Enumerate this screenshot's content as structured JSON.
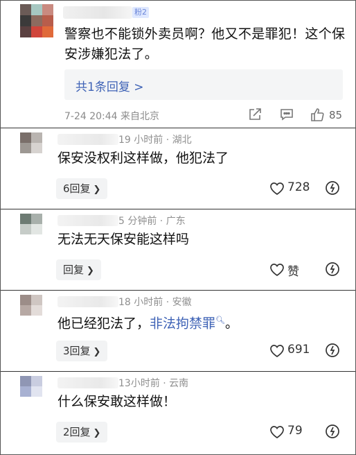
{
  "top_comment": {
    "badge": "粉2",
    "text": "警察也不能锁外卖员啊？他又不是罪犯！这个保安涉嫌犯法了。",
    "reply_link": "共1条回复 >",
    "meta": "7-24 20:44  来自北京",
    "like_count": "85",
    "avatar_colors": [
      "#6b5b57",
      "#a6c7c1",
      "#c98a80",
      "#3b3a3a",
      "#8d6b5f",
      "#b85d4b",
      "#5a4040",
      "#d0453b",
      "#e06a3a"
    ]
  },
  "comments": [
    {
      "time": "19 小时前 · 湖北",
      "text": "保安没权利这样做，他犯法了",
      "reply_label": "6回复",
      "like_count": "728",
      "avatar_colors": [
        "#7a6f6a",
        "#b9b4b0",
        "#9d9893",
        "#d7d3d0"
      ]
    },
    {
      "time": "5 分钟前 · 广东",
      "text": "无法无天保安能这样吗",
      "reply_label": "回复",
      "like_count": "赞",
      "avatar_colors": [
        "#6d7b73",
        "#a8b0ab",
        "#c6ccc8",
        "#e2e6e3"
      ]
    },
    {
      "time": "18 小时前 · 安徽",
      "text_before": "他已经犯法了，",
      "link_text": "非法拘禁罪",
      "text_after": "。",
      "reply_label": "3回复",
      "like_count": "691",
      "avatar_colors": [
        "#9c8d88",
        "#cfc6c2",
        "#b7a9a4",
        "#e3dcd9"
      ]
    },
    {
      "time": "13小时前 · 云南",
      "text": "什么保安敢这样做！",
      "reply_label": "2回复",
      "like_count": "79",
      "avatar_colors": [
        "#8f96b4",
        "#c9cde0",
        "#a8b1d2",
        "#e1e4f0"
      ]
    }
  ],
  "colors": {
    "link": "#3f63b6",
    "meta": "#8a8a8a",
    "border": "#333333"
  }
}
